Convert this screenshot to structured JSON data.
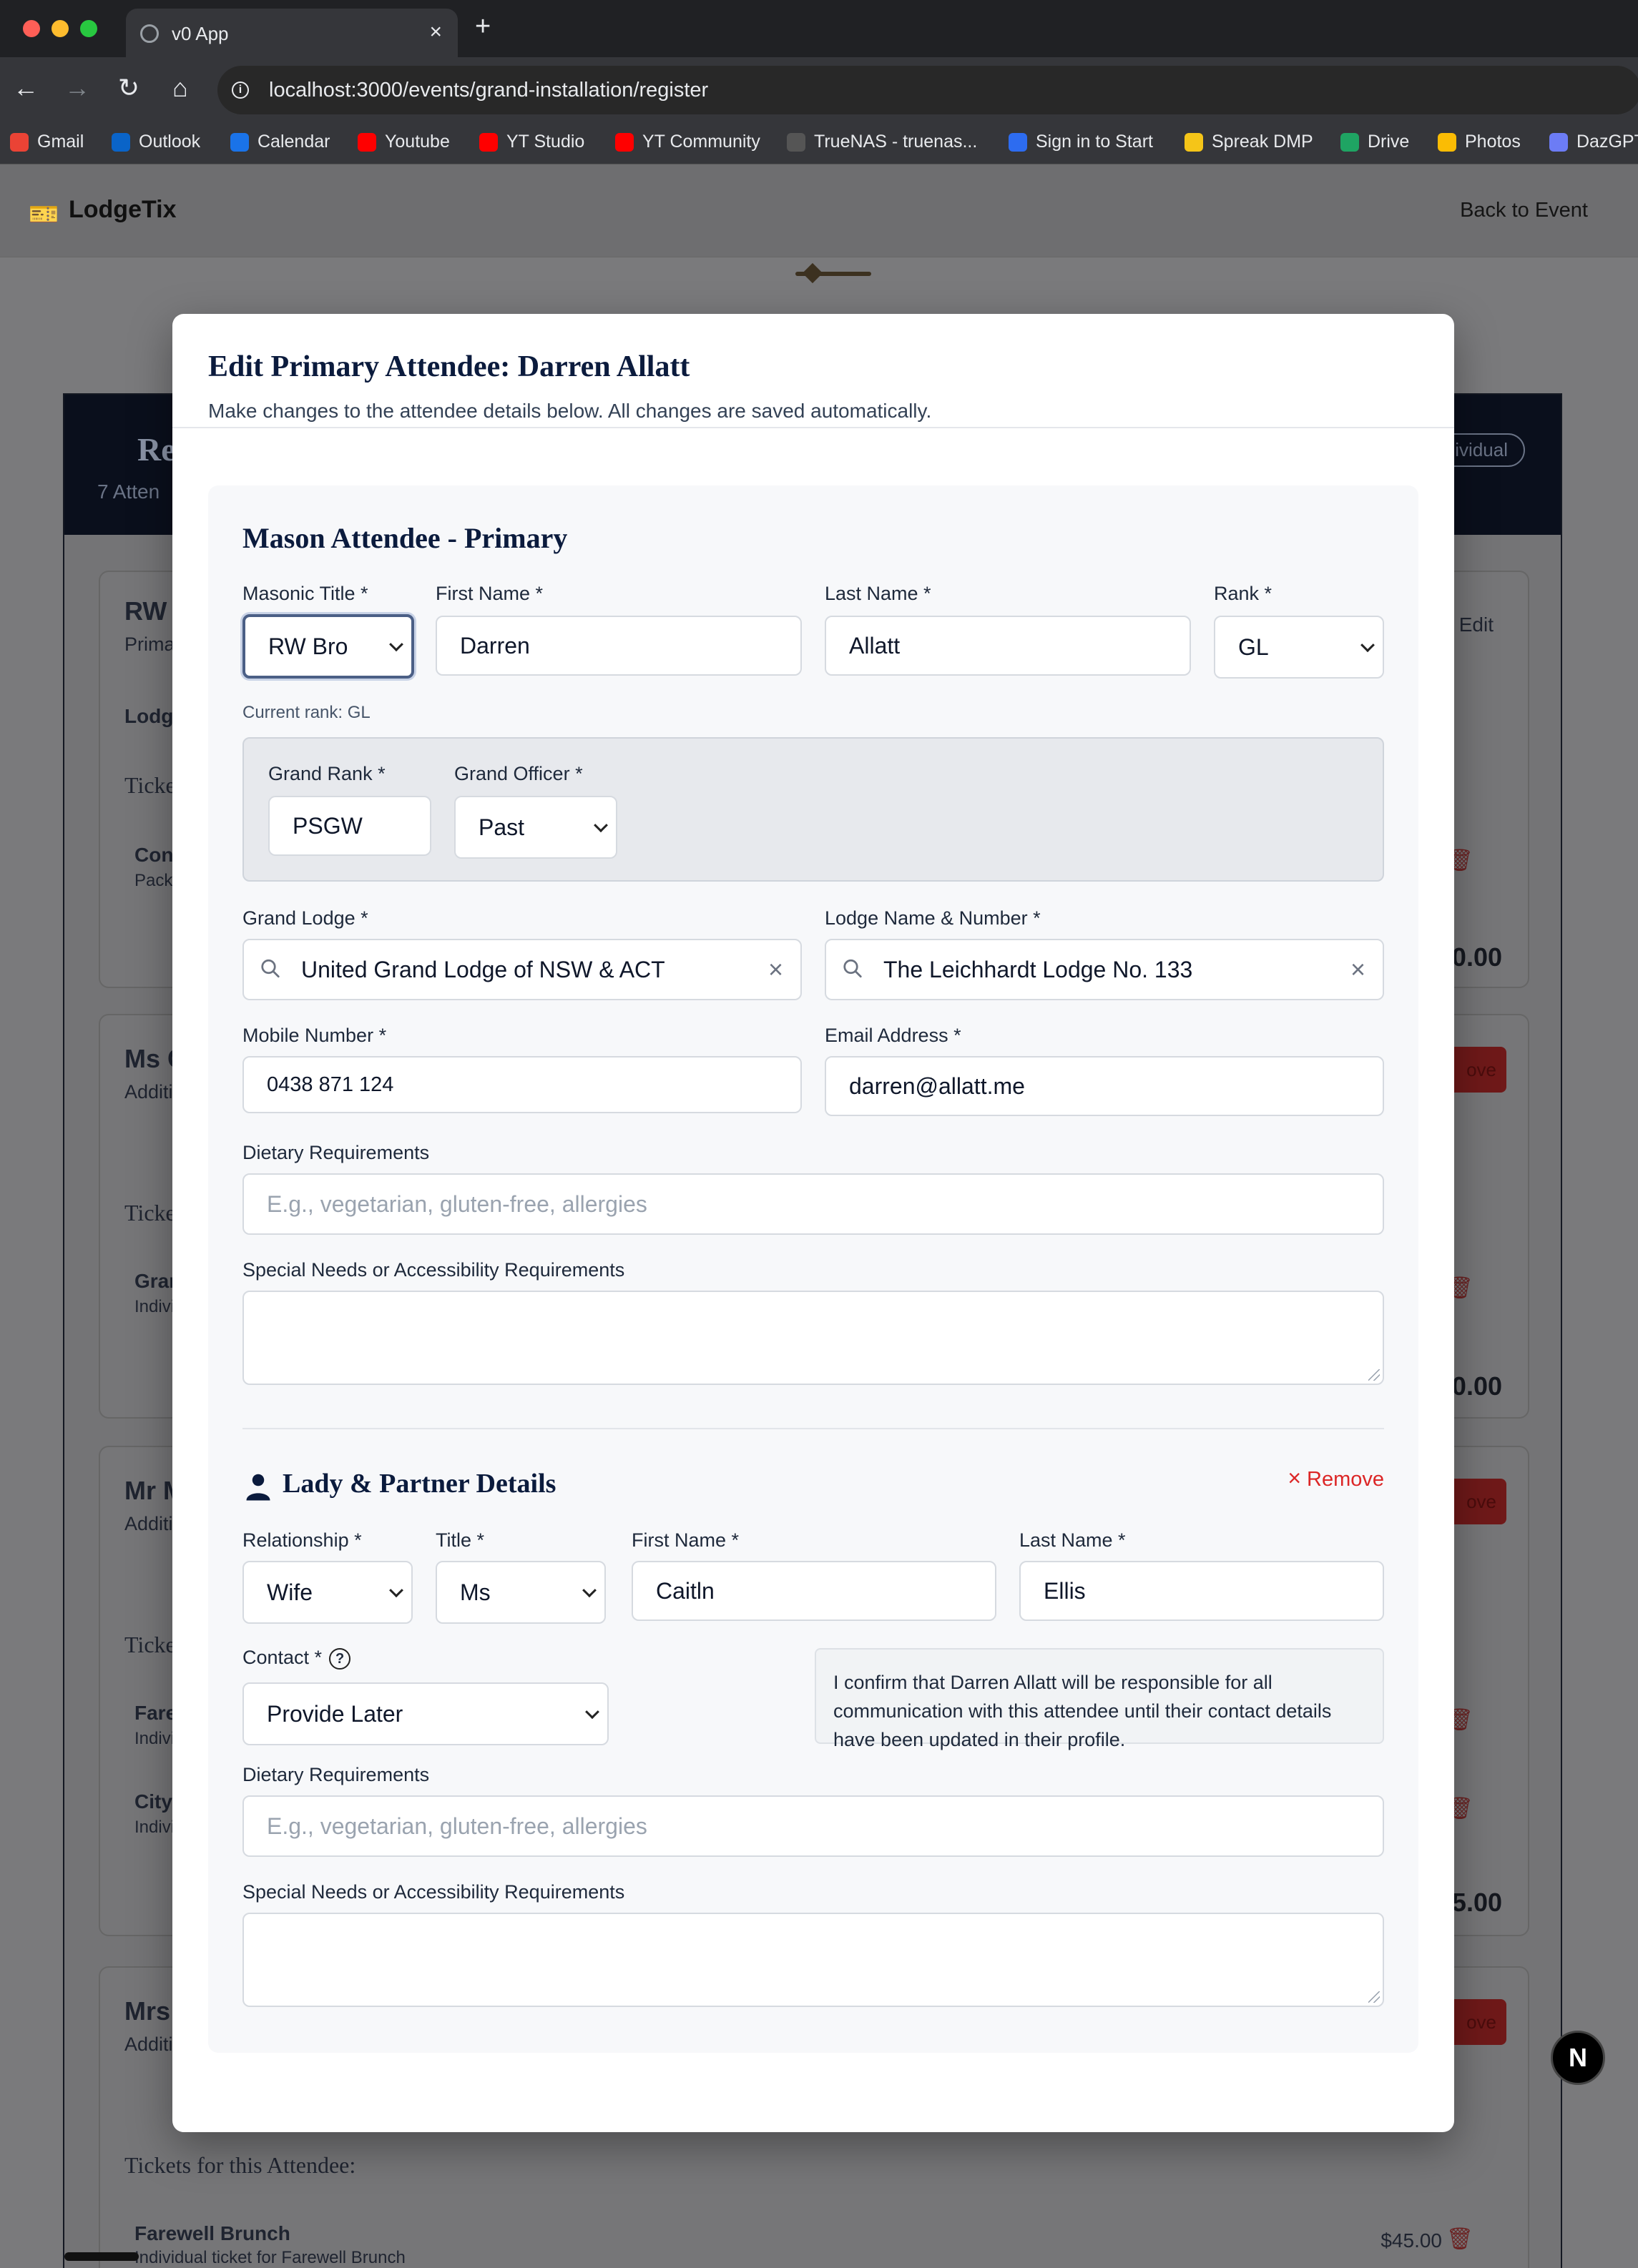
{
  "browser": {
    "tab_title": "v0 App",
    "url": "localhost:3000/events/grand-installation/register",
    "traffic_colors": [
      "#ff5f57",
      "#febc2e",
      "#28c840"
    ],
    "bookmarks": [
      {
        "label": "Gmail",
        "icon": "gmail-icon",
        "color": "#ea4335"
      },
      {
        "label": "Outlook",
        "icon": "outlook-icon",
        "color": "#0a64c8"
      },
      {
        "label": "Calendar",
        "icon": "calendar-icon",
        "color": "#1a73e8"
      },
      {
        "label": "Youtube",
        "icon": "youtube-icon",
        "color": "#ff0000"
      },
      {
        "label": "YT Studio",
        "icon": "youtube-icon",
        "color": "#ff0000"
      },
      {
        "label": "YT Community",
        "icon": "youtube-icon",
        "color": "#ff0000"
      },
      {
        "label": "TrueNAS - truenas...",
        "icon": "truenas-icon",
        "color": "#555555"
      },
      {
        "label": "Sign in to Start",
        "icon": "zoom-icon",
        "color": "#2d6cf0"
      },
      {
        "label": "Spreak DMP",
        "icon": "star-icon",
        "color": "#f5c518"
      },
      {
        "label": "Drive",
        "icon": "drive-icon",
        "color": "#1fa463"
      },
      {
        "label": "Photos",
        "icon": "photos-icon",
        "color": "#fbbc04"
      },
      {
        "label": "DazGPT",
        "icon": "dazgpt-icon",
        "color": "#6c7cf5"
      }
    ]
  },
  "app": {
    "brand": "LodgeTix",
    "back_link": "Back to Event"
  },
  "background": {
    "header_title": "Re",
    "header_sub": "7 Atten",
    "header_badge": "ividual",
    "cards": [
      {
        "title": "RW B",
        "sub": "Prima",
        "row1": "Lodg",
        "row2": "Ticke",
        "row3": "Con",
        "row4": "Pack",
        "action": "Edit",
        "price": "0.00"
      },
      {
        "title": "Ms C",
        "sub": "Additi",
        "row1": "Ticke",
        "row2": "Gran",
        "row3": "Indivi",
        "action": "ove",
        "price": "0.00"
      },
      {
        "title": "Mr M",
        "sub": "Additi",
        "row1": "Ticke",
        "row2": "Fare",
        "row3": "Indivi",
        "row4": "City",
        "row5": "Indivi",
        "action": "ove",
        "price": "5.00"
      },
      {
        "title": "Mrs",
        "sub": "Additi",
        "action": "ove"
      }
    ],
    "tickets_heading": "Tickets for this Attendee:",
    "ticket_name": "Farewell Brunch",
    "ticket_desc": "Individual ticket for Farewell Brunch",
    "ticket_price": "$45.00"
  },
  "modal": {
    "title": "Edit Primary Attendee: Darren Allatt",
    "subtitle": "Make changes to the attendee details below. All changes are saved automatically.",
    "section_title": "Mason Attendee - Primary",
    "mason": {
      "masonic_title": {
        "label": "Masonic Title *",
        "value": "RW Bro"
      },
      "first_name": {
        "label": "First Name *",
        "value": "Darren"
      },
      "last_name": {
        "label": "Last Name *",
        "value": "Allatt"
      },
      "rank": {
        "label": "Rank *",
        "value": "GL"
      },
      "current_rank": "Current rank: GL",
      "grand_rank": {
        "label": "Grand Rank *",
        "value": "PSGW"
      },
      "grand_officer": {
        "label": "Grand Officer *",
        "value": "Past"
      },
      "grand_lodge": {
        "label": "Grand Lodge *",
        "value": "United Grand Lodge of NSW & ACT"
      },
      "lodge": {
        "label": "Lodge Name & Number *",
        "value": "The Leichhardt Lodge No. 133"
      },
      "mobile": {
        "label": "Mobile Number *",
        "value": "0438 871 124"
      },
      "email": {
        "label": "Email Address *",
        "value": "darren@allatt.me"
      },
      "dietary": {
        "label": "Dietary Requirements",
        "placeholder": "E.g., vegetarian, gluten-free, allergies"
      },
      "special": {
        "label": "Special Needs or Accessibility Requirements",
        "value": ""
      }
    },
    "partner": {
      "title": "Lady & Partner Details",
      "remove_label": "Remove",
      "relationship": {
        "label": "Relationship *",
        "value": "Wife"
      },
      "title_field": {
        "label": "Title *",
        "value": "Ms"
      },
      "first_name": {
        "label": "First Name *",
        "value": "Caitln"
      },
      "last_name": {
        "label": "Last Name *",
        "value": "Ellis"
      },
      "contact": {
        "label": "Contact *",
        "value": "Provide Later"
      },
      "notice": "I confirm that Darren Allatt will be responsible for all communication with this attendee until their contact details have been updated in their profile.",
      "dietary": {
        "label": "Dietary Requirements",
        "placeholder": "E.g., vegetarian, gluten-free, allergies"
      },
      "special": {
        "label": "Special Needs or Accessibility Requirements",
        "value": ""
      }
    }
  }
}
